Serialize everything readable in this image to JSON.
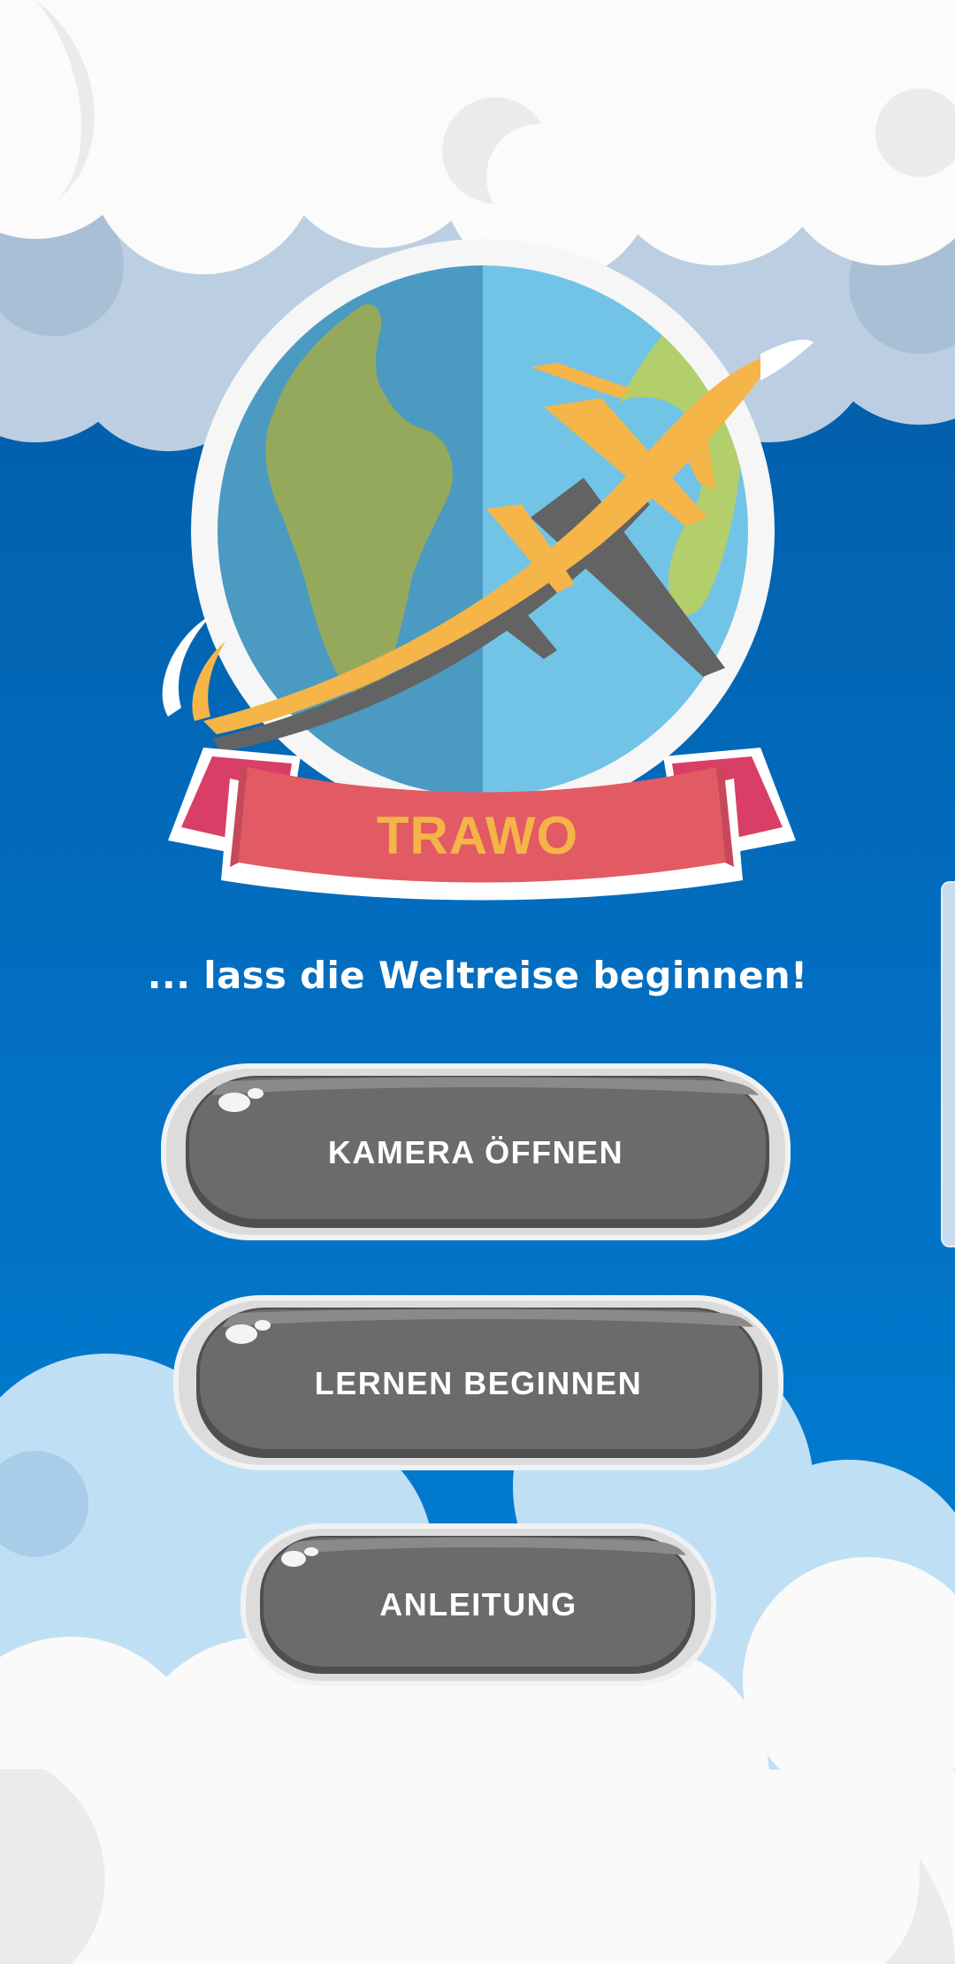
{
  "app": {
    "logo_text": "TRAWO",
    "tagline": "... lass die Weltreise beginnen!"
  },
  "buttons": {
    "camera": "KAMERA ÖFFNEN",
    "learn": "LERNEN BEGINNEN",
    "guide": "ANLEITUNG"
  },
  "colors": {
    "sky_top": "#02569e",
    "sky_bottom": "#0086d8",
    "cloud_white": "#fafafa",
    "cloud_blue": "#bfdff5",
    "globe_dark": "#4b9ac2",
    "globe_light": "#72c4e6",
    "land": "#95a95d",
    "plane": "#f5b548",
    "ribbon": "#e25a63",
    "button": "#6b6b6b"
  }
}
